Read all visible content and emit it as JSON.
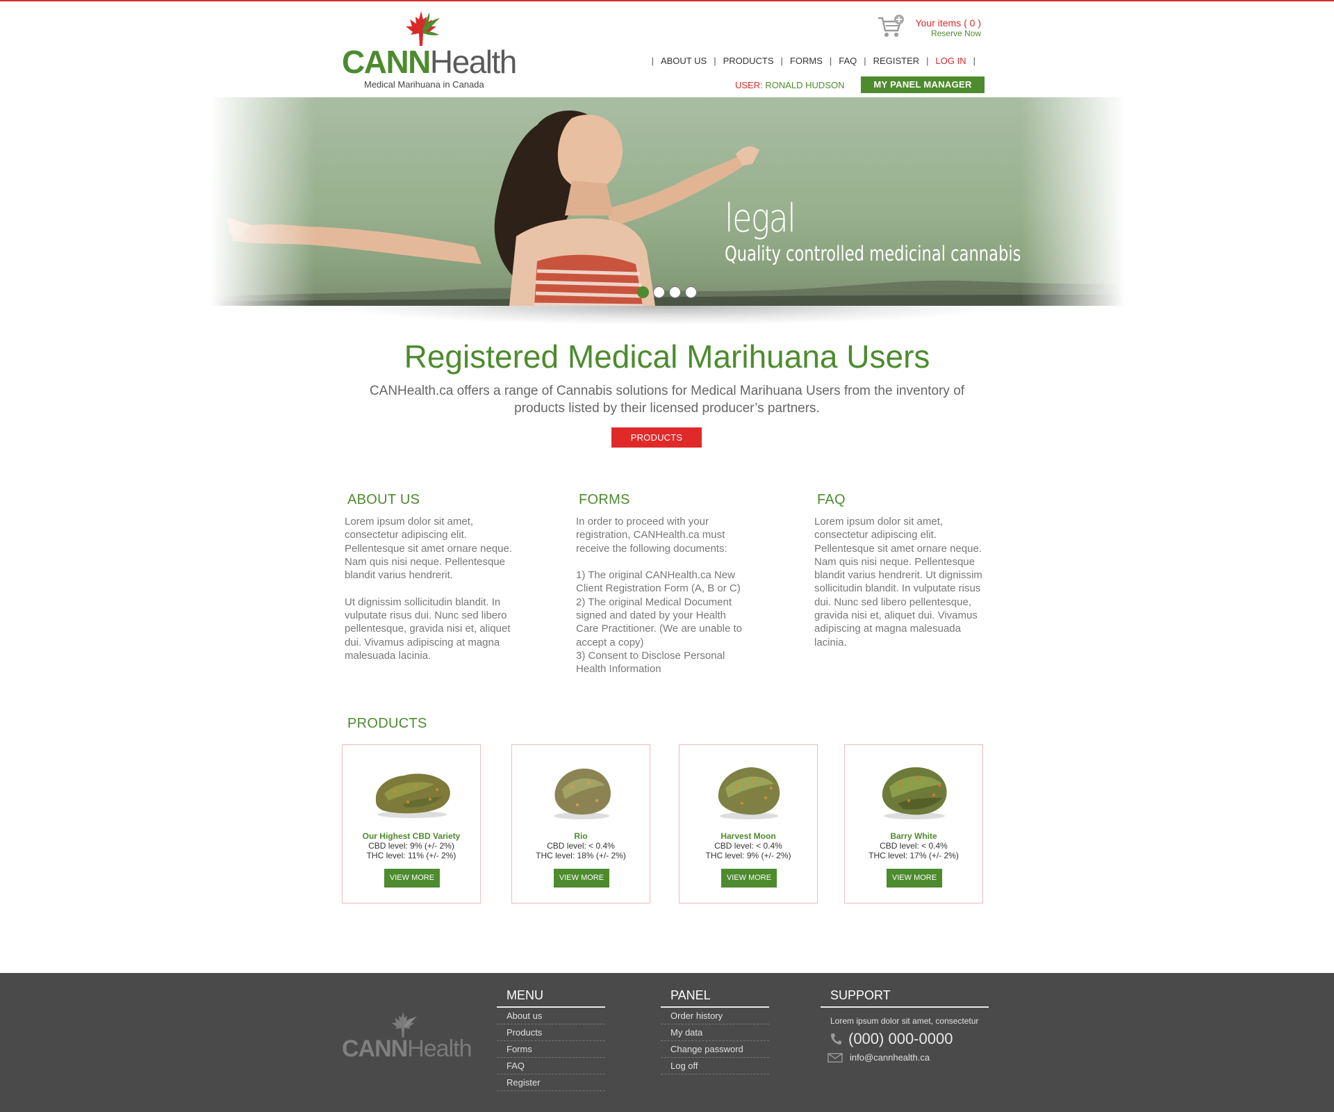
{
  "header": {
    "brand_bold": "CANN",
    "brand_light": "Health",
    "tagline": "Medical Marihuana in Canada",
    "cart_items": "Your items ( 0 )",
    "cart_reserve": "Reserve Now",
    "nav": [
      "ABOUT US",
      "PRODUCTS",
      "FORMS",
      "FAQ",
      "REGISTER",
      "LOG IN"
    ],
    "user_label": "USER:",
    "user_name": "RONALD HUDSON",
    "panel_button": "MY PANEL  MANAGER"
  },
  "hero": {
    "title": "legal",
    "subtitle": "Quality controlled medicinal cannabis",
    "slides": 4,
    "active_slide": 1
  },
  "intro": {
    "title": "Registered Medical Marihuana Users",
    "text": "CANHealth.ca offers a range of Cannabis solutions for Medical Marihuana Users from the inventory of products listed by their licensed producer’s partners.",
    "button": "PRODUCTS"
  },
  "columns": [
    {
      "title": "ABOUT US",
      "text": "Lorem ipsum dolor sit amet,\nconsectetur adipiscing elit.\nPellentesque sit amet ornare neque.\nNam quis nisi neque. Pellentesque\nblandit varius hendrerit.\n\nUt dignissim sollicitudin blandit. In\nvulputate risus dui. Nunc sed libero\npellentesque, gravida nisi et, aliquet\ndui. Vivamus adipiscing at magna\nmalesuada lacinia."
    },
    {
      "title": "FORMS",
      "text": "In order to proceed with your\nregistration, CANHealth.ca must\nreceive the following documents:\n\n1) The original CANHealth.ca New\nClient Registration Form (A, B or C)\n2) The original Medical Document\nsigned and dated by your Health\nCare Practitioner. (We are unable to\naccept a copy)\n3) Consent to Disclose Personal\nHealth Information"
    },
    {
      "title": "FAQ",
      "text": "Lorem ipsum dolor sit amet,\nconsectetur adipiscing elit.\nPellentesque sit amet ornare neque.\nNam quis nisi neque. Pellentesque\nblandit varius hendrerit. Ut dignissim\nsollicitudin blandit. In vulputate risus\ndui. Nunc sed libero pellentesque,\ngravida nisi et, aliquet dui. Vivamus\nadipiscing at magna malesuada\nlacinia."
    }
  ],
  "products": {
    "title": "PRODUCTS",
    "items": [
      {
        "name": "Our Highest CBD Variety",
        "cbd": "CBD level: 9% (+/- 2%)",
        "thc": "THC level: 11% (+/- 2%)",
        "button": "VIEW MORE"
      },
      {
        "name": "Rio",
        "cbd": "CBD level: < 0.4%",
        "thc": "THC level: 18% (+/- 2%)",
        "button": "VIEW MORE"
      },
      {
        "name": "Harvest Moon",
        "cbd": "CBD level: < 0.4%",
        "thc": "THC level: 9% (+/- 2%)",
        "button": "VIEW MORE"
      },
      {
        "name": "Barry White",
        "cbd": "CBD level: < 0.4%",
        "thc": "THC level: 17% (+/- 2%)",
        "button": "VIEW MORE"
      }
    ]
  },
  "footer": {
    "brand_bold": "CANN",
    "brand_light": "Health",
    "menu": {
      "title": "MENU",
      "items": [
        "About us",
        "Products",
        "Forms",
        "FAQ",
        "Register"
      ]
    },
    "panel": {
      "title": "PANEL",
      "items": [
        "Order history",
        "My data",
        "Change password",
        "Log off"
      ]
    },
    "support": {
      "title": "SUPPORT",
      "text": "Lorem ipsum dolor sit amet, consectetur",
      "phone": "(000) 000-0000",
      "email": "info@cannhealth.ca"
    }
  },
  "colors": {
    "brand_green": "#4d8b2e",
    "accent_red": "#e02a2a",
    "footer_bg": "#4a4a4a"
  }
}
